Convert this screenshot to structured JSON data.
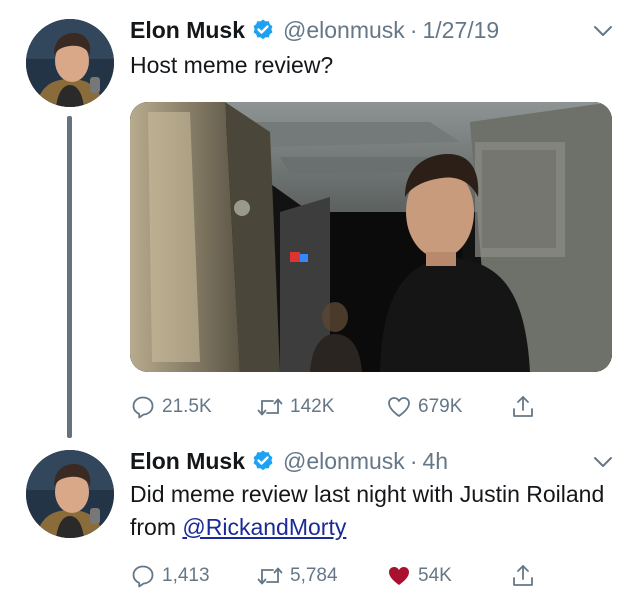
{
  "tweets": [
    {
      "display_name": "Elon Musk",
      "handle": "@elonmusk",
      "separator": "·",
      "time": "1/27/19",
      "text": "Host meme review?",
      "has_media": true,
      "replies": "21.5K",
      "retweets": "142K",
      "likes": "679K",
      "liked": false
    },
    {
      "display_name": "Elon Musk",
      "handle": "@elonmusk",
      "separator": "·",
      "time": "4h",
      "text_before_mention": "Did meme review last night with Justin Roiland from ",
      "mention": "@RickandMorty",
      "has_media": false,
      "replies": "1,413",
      "retweets": "5,784",
      "likes": "54K",
      "liked": true
    }
  ],
  "colors": {
    "verified_badge": "#1da1f2",
    "liked_heart": "#a8102e",
    "mention": "#1b2a99",
    "muted": "#657786",
    "thread_line": "#66727d"
  },
  "icons": {
    "verified": "verified-badge-icon",
    "caret": "chevron-down-icon",
    "reply": "reply-bubble-icon",
    "retweet": "retweet-icon",
    "like": "heart-icon",
    "share": "share-icon"
  }
}
